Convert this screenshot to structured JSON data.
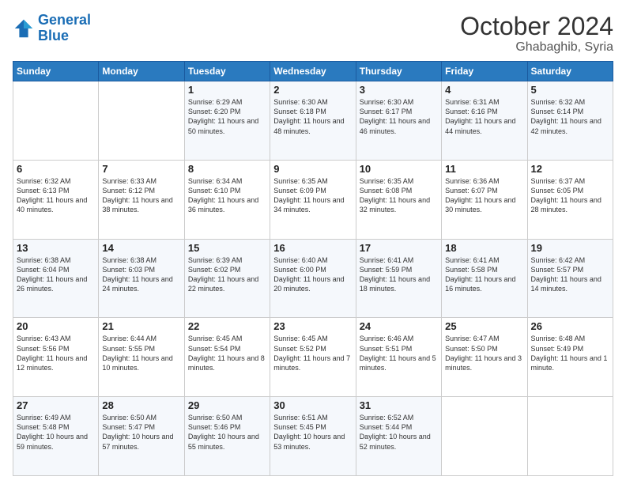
{
  "logo": {
    "text1": "General",
    "text2": "Blue"
  },
  "header": {
    "month": "October 2024",
    "location": "Ghabaghib, Syria"
  },
  "weekdays": [
    "Sunday",
    "Monday",
    "Tuesday",
    "Wednesday",
    "Thursday",
    "Friday",
    "Saturday"
  ],
  "weeks": [
    [
      null,
      null,
      {
        "day": 1,
        "sunrise": "Sunrise: 6:29 AM",
        "sunset": "Sunset: 6:20 PM",
        "daylight": "Daylight: 11 hours and 50 minutes."
      },
      {
        "day": 2,
        "sunrise": "Sunrise: 6:30 AM",
        "sunset": "Sunset: 6:18 PM",
        "daylight": "Daylight: 11 hours and 48 minutes."
      },
      {
        "day": 3,
        "sunrise": "Sunrise: 6:30 AM",
        "sunset": "Sunset: 6:17 PM",
        "daylight": "Daylight: 11 hours and 46 minutes."
      },
      {
        "day": 4,
        "sunrise": "Sunrise: 6:31 AM",
        "sunset": "Sunset: 6:16 PM",
        "daylight": "Daylight: 11 hours and 44 minutes."
      },
      {
        "day": 5,
        "sunrise": "Sunrise: 6:32 AM",
        "sunset": "Sunset: 6:14 PM",
        "daylight": "Daylight: 11 hours and 42 minutes."
      }
    ],
    [
      {
        "day": 6,
        "sunrise": "Sunrise: 6:32 AM",
        "sunset": "Sunset: 6:13 PM",
        "daylight": "Daylight: 11 hours and 40 minutes."
      },
      {
        "day": 7,
        "sunrise": "Sunrise: 6:33 AM",
        "sunset": "Sunset: 6:12 PM",
        "daylight": "Daylight: 11 hours and 38 minutes."
      },
      {
        "day": 8,
        "sunrise": "Sunrise: 6:34 AM",
        "sunset": "Sunset: 6:10 PM",
        "daylight": "Daylight: 11 hours and 36 minutes."
      },
      {
        "day": 9,
        "sunrise": "Sunrise: 6:35 AM",
        "sunset": "Sunset: 6:09 PM",
        "daylight": "Daylight: 11 hours and 34 minutes."
      },
      {
        "day": 10,
        "sunrise": "Sunrise: 6:35 AM",
        "sunset": "Sunset: 6:08 PM",
        "daylight": "Daylight: 11 hours and 32 minutes."
      },
      {
        "day": 11,
        "sunrise": "Sunrise: 6:36 AM",
        "sunset": "Sunset: 6:07 PM",
        "daylight": "Daylight: 11 hours and 30 minutes."
      },
      {
        "day": 12,
        "sunrise": "Sunrise: 6:37 AM",
        "sunset": "Sunset: 6:05 PM",
        "daylight": "Daylight: 11 hours and 28 minutes."
      }
    ],
    [
      {
        "day": 13,
        "sunrise": "Sunrise: 6:38 AM",
        "sunset": "Sunset: 6:04 PM",
        "daylight": "Daylight: 11 hours and 26 minutes."
      },
      {
        "day": 14,
        "sunrise": "Sunrise: 6:38 AM",
        "sunset": "Sunset: 6:03 PM",
        "daylight": "Daylight: 11 hours and 24 minutes."
      },
      {
        "day": 15,
        "sunrise": "Sunrise: 6:39 AM",
        "sunset": "Sunset: 6:02 PM",
        "daylight": "Daylight: 11 hours and 22 minutes."
      },
      {
        "day": 16,
        "sunrise": "Sunrise: 6:40 AM",
        "sunset": "Sunset: 6:00 PM",
        "daylight": "Daylight: 11 hours and 20 minutes."
      },
      {
        "day": 17,
        "sunrise": "Sunrise: 6:41 AM",
        "sunset": "Sunset: 5:59 PM",
        "daylight": "Daylight: 11 hours and 18 minutes."
      },
      {
        "day": 18,
        "sunrise": "Sunrise: 6:41 AM",
        "sunset": "Sunset: 5:58 PM",
        "daylight": "Daylight: 11 hours and 16 minutes."
      },
      {
        "day": 19,
        "sunrise": "Sunrise: 6:42 AM",
        "sunset": "Sunset: 5:57 PM",
        "daylight": "Daylight: 11 hours and 14 minutes."
      }
    ],
    [
      {
        "day": 20,
        "sunrise": "Sunrise: 6:43 AM",
        "sunset": "Sunset: 5:56 PM",
        "daylight": "Daylight: 11 hours and 12 minutes."
      },
      {
        "day": 21,
        "sunrise": "Sunrise: 6:44 AM",
        "sunset": "Sunset: 5:55 PM",
        "daylight": "Daylight: 11 hours and 10 minutes."
      },
      {
        "day": 22,
        "sunrise": "Sunrise: 6:45 AM",
        "sunset": "Sunset: 5:54 PM",
        "daylight": "Daylight: 11 hours and 8 minutes."
      },
      {
        "day": 23,
        "sunrise": "Sunrise: 6:45 AM",
        "sunset": "Sunset: 5:52 PM",
        "daylight": "Daylight: 11 hours and 7 minutes."
      },
      {
        "day": 24,
        "sunrise": "Sunrise: 6:46 AM",
        "sunset": "Sunset: 5:51 PM",
        "daylight": "Daylight: 11 hours and 5 minutes."
      },
      {
        "day": 25,
        "sunrise": "Sunrise: 6:47 AM",
        "sunset": "Sunset: 5:50 PM",
        "daylight": "Daylight: 11 hours and 3 minutes."
      },
      {
        "day": 26,
        "sunrise": "Sunrise: 6:48 AM",
        "sunset": "Sunset: 5:49 PM",
        "daylight": "Daylight: 11 hours and 1 minute."
      }
    ],
    [
      {
        "day": 27,
        "sunrise": "Sunrise: 6:49 AM",
        "sunset": "Sunset: 5:48 PM",
        "daylight": "Daylight: 10 hours and 59 minutes."
      },
      {
        "day": 28,
        "sunrise": "Sunrise: 6:50 AM",
        "sunset": "Sunset: 5:47 PM",
        "daylight": "Daylight: 10 hours and 57 minutes."
      },
      {
        "day": 29,
        "sunrise": "Sunrise: 6:50 AM",
        "sunset": "Sunset: 5:46 PM",
        "daylight": "Daylight: 10 hours and 55 minutes."
      },
      {
        "day": 30,
        "sunrise": "Sunrise: 6:51 AM",
        "sunset": "Sunset: 5:45 PM",
        "daylight": "Daylight: 10 hours and 53 minutes."
      },
      {
        "day": 31,
        "sunrise": "Sunrise: 6:52 AM",
        "sunset": "Sunset: 5:44 PM",
        "daylight": "Daylight: 10 hours and 52 minutes."
      },
      null,
      null
    ]
  ]
}
